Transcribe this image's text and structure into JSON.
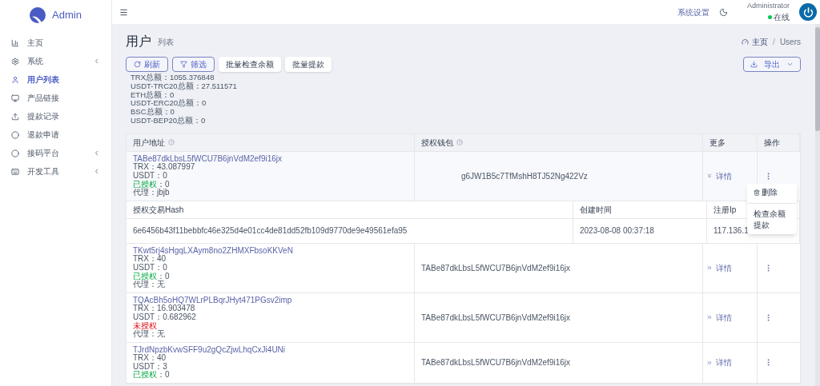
{
  "brand": "Admin",
  "sidebar": {
    "items": [
      {
        "label": "主页",
        "kind": "chart",
        "selected": false,
        "has_submenu": false
      },
      {
        "label": "系统",
        "kind": "gear",
        "selected": false,
        "has_submenu": true
      },
      {
        "label": "用户列表",
        "kind": "user",
        "selected": true,
        "has_submenu": false
      },
      {
        "label": "产品链接",
        "kind": "monitor",
        "selected": false,
        "has_submenu": false
      },
      {
        "label": "提款记录",
        "kind": "upload",
        "selected": false,
        "has_submenu": false
      },
      {
        "label": "退款申请",
        "kind": "circle",
        "selected": false,
        "has_submenu": false
      },
      {
        "label": "接码平台",
        "kind": "circle",
        "selected": false,
        "has_submenu": true
      },
      {
        "label": "开发工具",
        "kind": "keyboard",
        "selected": false,
        "has_submenu": true
      }
    ]
  },
  "topbar": {
    "settings": "系统设置",
    "user": "Administrator",
    "status": "在线"
  },
  "page": {
    "title": "用户",
    "subtitle": "列表",
    "breadcrumb": [
      "主页",
      "Users"
    ],
    "breadcrumb_separator": "/"
  },
  "toolbar": {
    "buttons": [
      {
        "label": "刷新",
        "kind": "refresh"
      },
      {
        "label": "筛选",
        "kind": "filter"
      },
      {
        "label": "批量检查余额",
        "kind": "plain"
      },
      {
        "label": "批量提款",
        "kind": "plain"
      }
    ],
    "export": "导出"
  },
  "totals": [
    "TRX总额：1055.376848",
    "USDT-TRC20总额：27.511571",
    "ETH总额：0",
    "USDT-ERC20总额：0",
    "BSC总额：0",
    "USDT-BEP20总额：0"
  ],
  "table": {
    "columns": [
      "用户地址",
      "授权钱包",
      "更多",
      "操作"
    ],
    "rows": [
      {
        "address": "TABe87dkLbsL5fWCU7B6jnVdM2ef9i16jx",
        "trx": "TRX：43.087997",
        "usdt": "USDT：0",
        "authorized": true,
        "auth_label": "已授权",
        "auth_value": "：0",
        "agent": "代理：jbjb",
        "wallet": "g6JW1B5c7TfMshH8TJ52Ng422Vz",
        "more": "详情",
        "expanded": true,
        "detail": {
          "columns": [
            "授权交易Hash",
            "创建时间",
            "注册Ip"
          ],
          "values": [
            "6e6456b43f11bebbfc46e325d4e01cc4de81dd52fb109d9770de9e49561efa95",
            "2023-08-08 00:37:18",
            "117.136.1"
          ]
        }
      },
      {
        "address": "TKwt5rj4sHgqLXAym8no2ZHMXFbsoKKVeN",
        "trx": "TRX：40",
        "usdt": "USDT：0",
        "authorized": true,
        "auth_label": "已授权",
        "auth_value": "：0",
        "agent": "代理：无",
        "wallet": "TABe87dkLbsL5fWCU7B6jnVdM2ef9i16jx",
        "more": "详情",
        "expanded": false
      },
      {
        "address": "TQAcBh5oHQ7WLrPLBqrJHyt471PGsv2imp",
        "trx": "TRX：16.903478",
        "usdt": "USDT：0.682962",
        "authorized": false,
        "auth_label": "未授权",
        "agent": "代理：无",
        "wallet": "TABe87dkLbsL5fWCU7B6jnVdM2ef9i16jx",
        "more": "详情",
        "expanded": false
      },
      {
        "address": "TJrdNpzbKvwSFF9u2gQcZjwLhqCxJi4UNi",
        "trx": "TRX：40",
        "usdt": "USDT：3",
        "authorized": true,
        "auth_label": "已授权",
        "auth_value": "：0",
        "wallet": "TABe87dkLbsL5fWCU7B6jnVdM2ef9i16jx",
        "more": "详情",
        "expanded": false
      }
    ]
  },
  "action_menu": {
    "items": [
      {
        "label": "删除",
        "kind": "delete"
      },
      {
        "label": "检查余额",
        "kind": "plain"
      },
      {
        "label": "提款",
        "kind": "plain"
      }
    ]
  }
}
